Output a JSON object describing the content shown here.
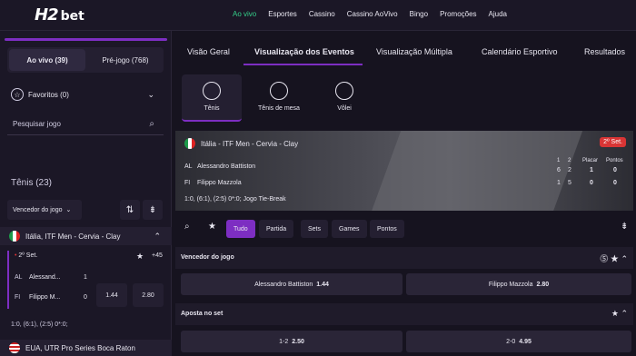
{
  "brand": {
    "logo_main": "H2",
    "logo_suffix": "bet"
  },
  "topnav": [
    "Ao vivo",
    "Esportes",
    "Cassino",
    "Cassino AoVivo",
    "Bingo",
    "Promoções",
    "Ajuda"
  ],
  "tabs": [
    "Visão Geral",
    "Visualização dos Eventos",
    "Visualização Múltipla",
    "Calendário Esportivo",
    "Resultados"
  ],
  "left": {
    "live": "Ao vivo (39)",
    "prematch": "Pré-jogo (768)",
    "favorites": "Favoritos (0)",
    "search_placeholder": "Pesquisar jogo",
    "sport_title": "Tênis (23)",
    "market": "Vencedor do jogo",
    "league1": "Itália, ITF Men - Cervia - Clay",
    "event": {
      "status": "2º Set.",
      "plus": "+45",
      "p1_code": "AL",
      "p1_name": "Alessand...",
      "p1_score": "1",
      "p2_code": "FI",
      "p2_name": "Filippo M...",
      "p2_score": "0",
      "odd1": "1.44",
      "odd2": "2.80",
      "score_line": "1:0, (6:1), (2:5) 0*:0;"
    },
    "league2": "EUA, UTR Pro Series Boca Raton"
  },
  "sports": [
    "Tênis",
    "Tênis de mesa",
    "Vôlei"
  ],
  "hero": {
    "title": "Itália - ITF Men - Cervia - Clay",
    "set": "2º Set.",
    "p1_code": "AL",
    "p1_name": "Alessandro Battiston",
    "p2_code": "FI",
    "p2_name": "Filippo Mazzola",
    "set_headers": [
      "1",
      "2"
    ],
    "p1_sets": [
      "6",
      "2"
    ],
    "p2_sets": [
      "1",
      "5"
    ],
    "placar_header": "Placar",
    "pontos_header": "Pontos",
    "p1_placar": "1",
    "p1_pontos": "0",
    "p2_placar": "0",
    "p2_pontos": "0",
    "info": "1:0, (6:1), (2:5) 0*:0;   Jogo Tie-Break"
  },
  "filters": [
    "Tudo",
    "Partida",
    "Sets",
    "Games",
    "Pontos"
  ],
  "markets": [
    {
      "title": "Vencedor do jogo",
      "options": [
        {
          "label": "Alessandro Battiston",
          "odd": "1.44"
        },
        {
          "label": "Filippo Mazzola",
          "odd": "2.80"
        }
      ]
    },
    {
      "title": "Aposta no set",
      "options": [
        {
          "label": "1-2",
          "odd": "2.50"
        },
        {
          "label": "2-0",
          "odd": "4.95"
        }
      ]
    }
  ],
  "colors": {
    "accent": "#7d2ec2",
    "live_green": "#35d08a",
    "set_badge": "#d93535"
  }
}
